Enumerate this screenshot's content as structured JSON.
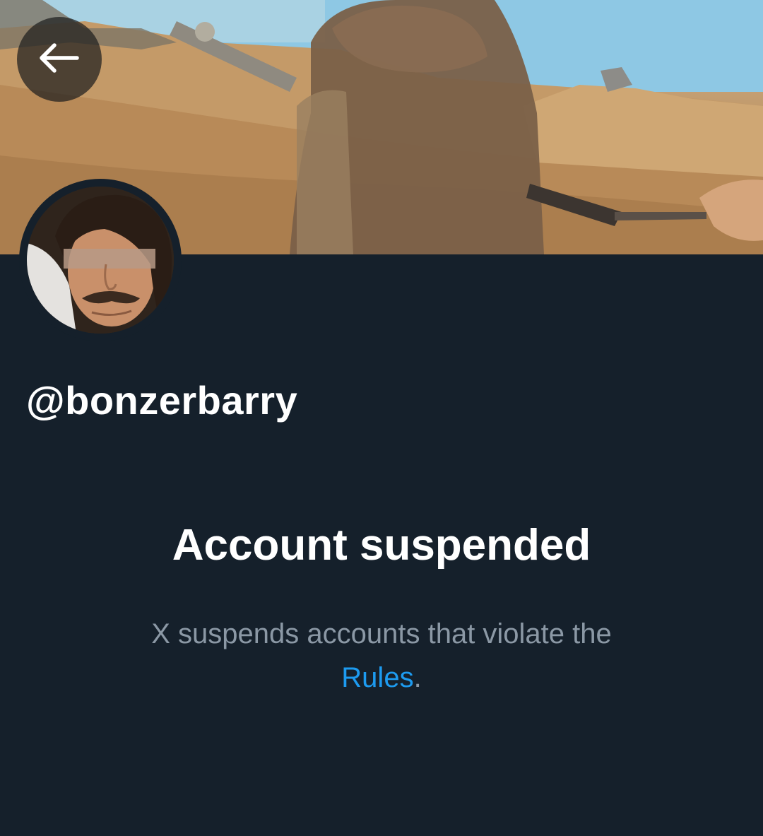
{
  "header": {
    "back_icon": "arrow-left-icon"
  },
  "profile": {
    "handle": "@bonzerbarry"
  },
  "suspension": {
    "title": "Account suspended",
    "message_text": "X suspends accounts that violate the",
    "rules_link": "Rules",
    "trailing_punctuation": "."
  },
  "colors": {
    "background": "#15202b",
    "link": "#1d9bf0",
    "secondary_text": "#8b98a5",
    "primary_text": "#ffffff"
  }
}
